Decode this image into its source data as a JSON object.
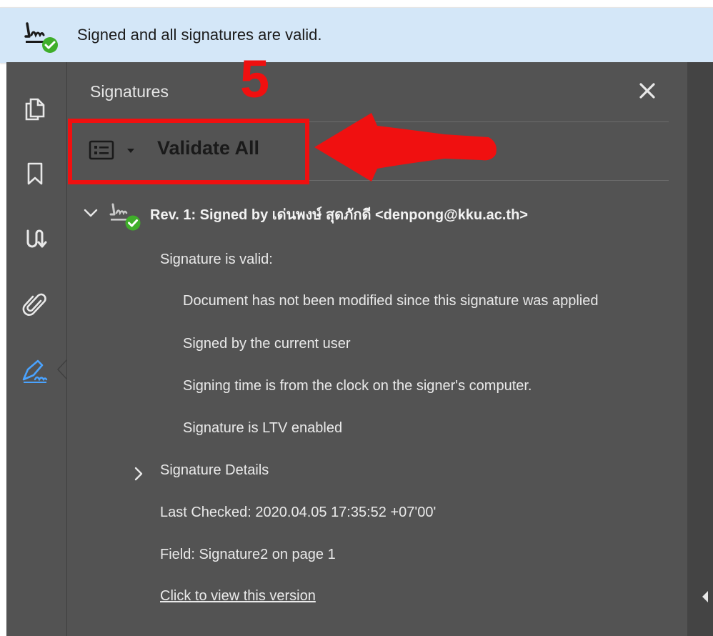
{
  "info_bar": {
    "message": "Signed and all signatures are valid."
  },
  "panel": {
    "title": "Signatures",
    "validate_all_label": "Validate All"
  },
  "annotation": {
    "step_number": "5",
    "color": "#f01010"
  },
  "signature": {
    "revision_title": "Rev. 1: Signed by เด่นพงษ์ สุดภักดี <denpong@kku.ac.th>",
    "status_heading": "Signature is valid:",
    "status_details": [
      "Document has not been modified since this signature was applied",
      "Signed by the current user",
      "Signing time is from the clock on the signer's computer.",
      "Signature is LTV enabled"
    ],
    "details_label": "Signature Details",
    "last_checked": "Last Checked: 2020.04.05 17:35:52 +07'00'",
    "field": "Field: Signature2 on page 1",
    "view_version_link": "Click to view this version"
  },
  "icons": {
    "rail": [
      "copy-pages-icon",
      "bookmark-icon",
      "order-icon",
      "attachment-icon",
      "signature-pen-icon"
    ],
    "info_bar": "signature-valid-icon"
  },
  "colors": {
    "info_bar_bg": "#d4e7f8",
    "panel_bg": "#535353",
    "valid_green": "#3fae2a",
    "active_blue": "#4aa3ff"
  }
}
